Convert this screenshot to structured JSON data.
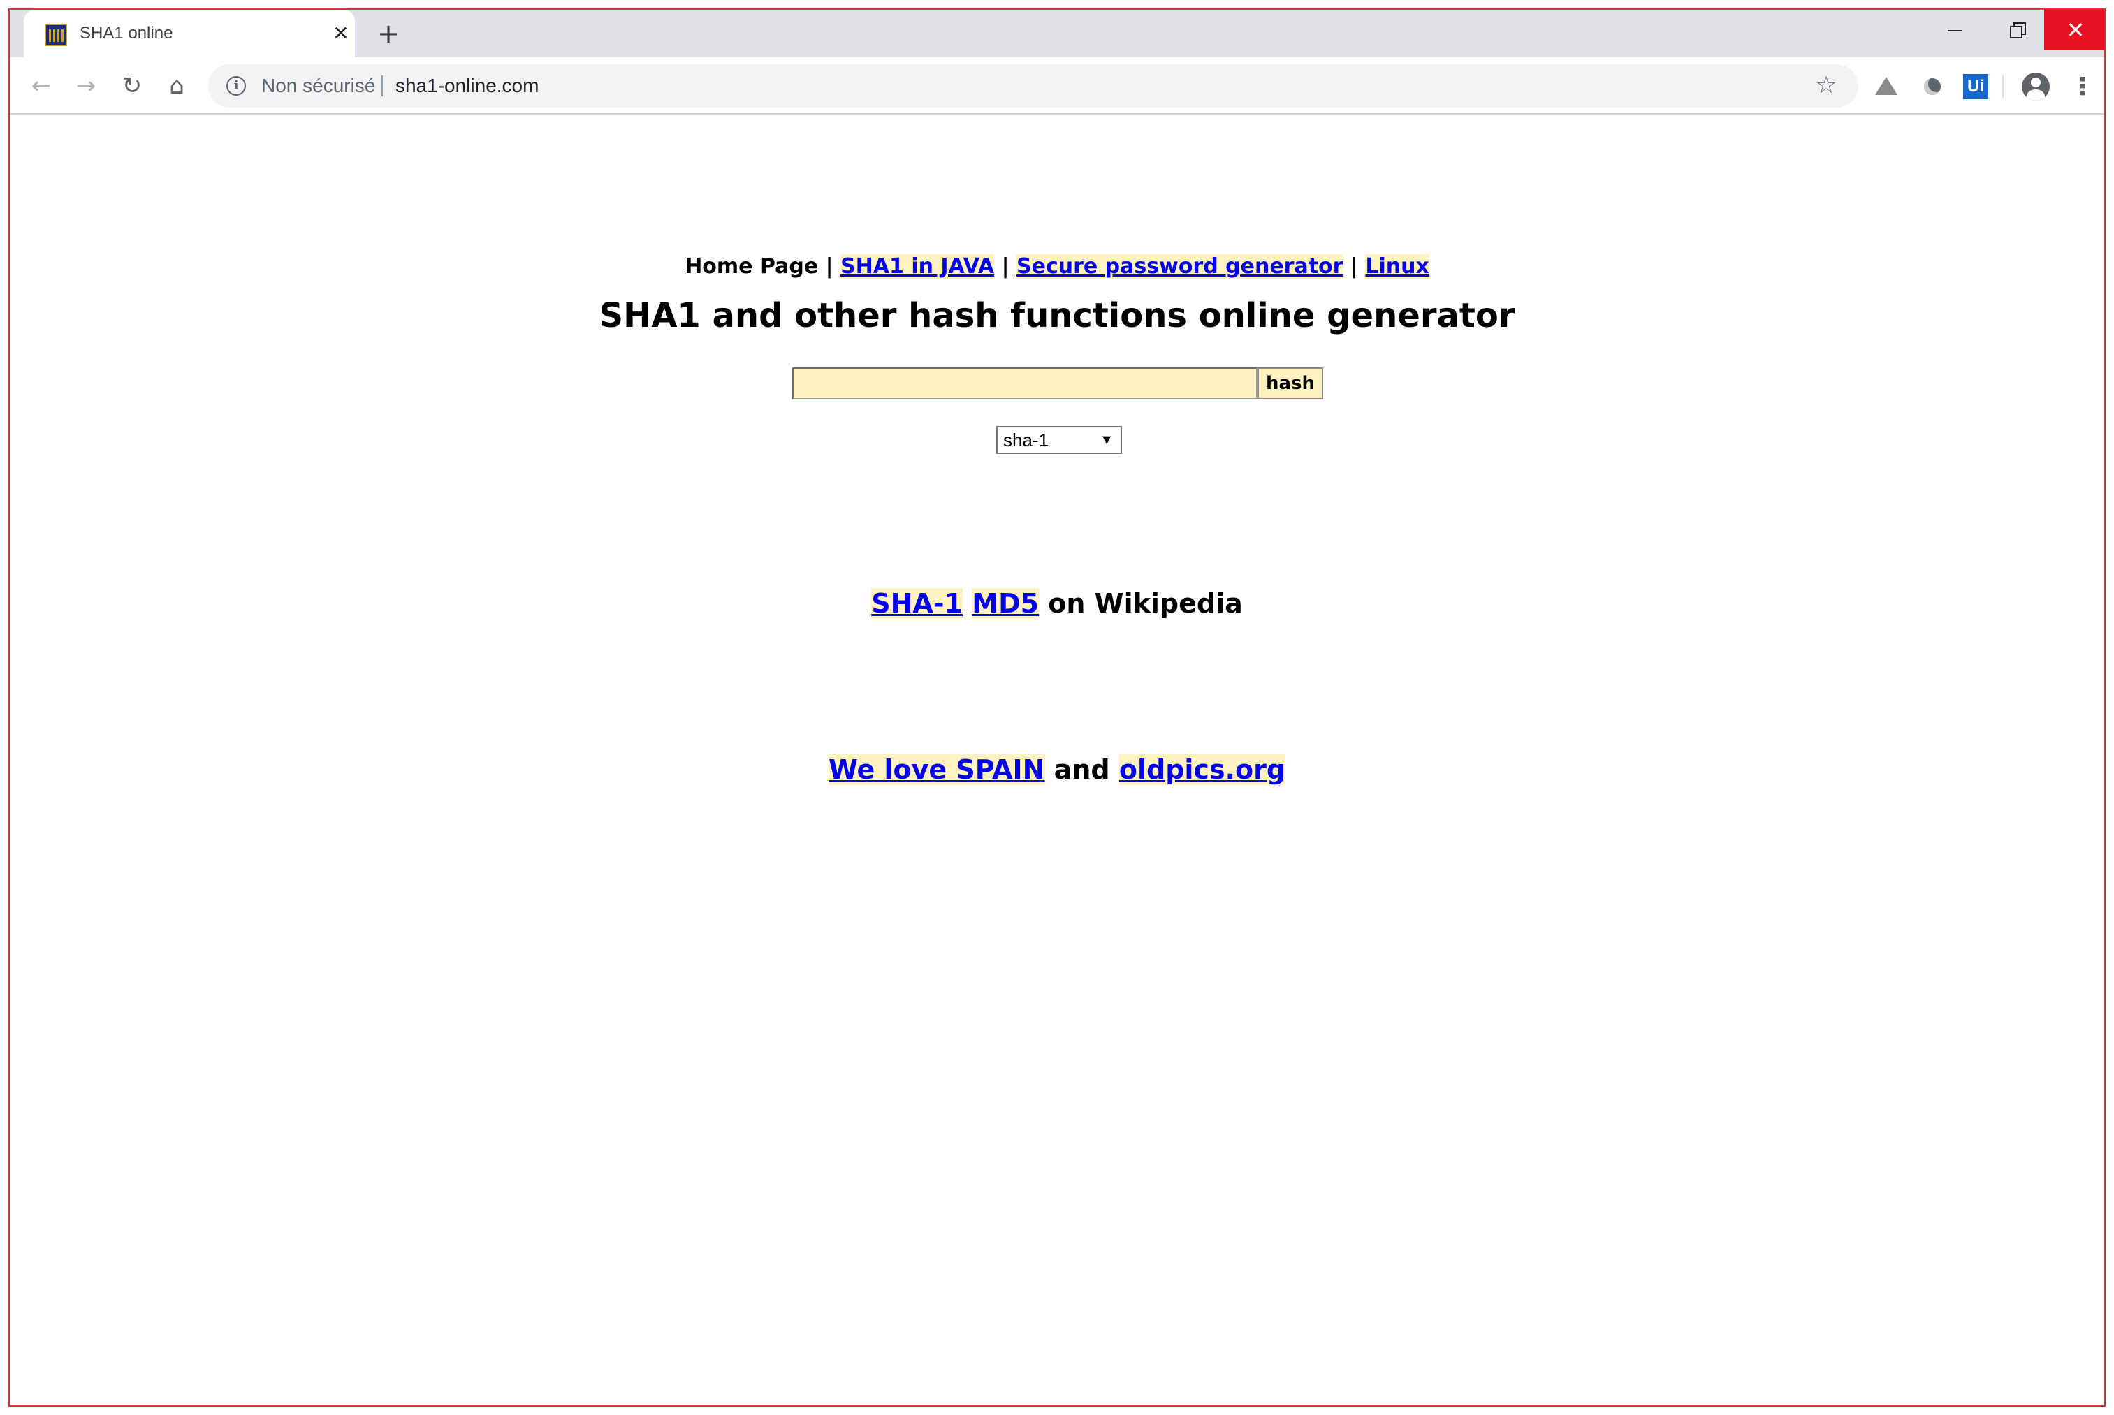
{
  "browser": {
    "tab": {
      "title": "SHA1 online",
      "close_glyph": "✕"
    },
    "new_tab_glyph": "+",
    "window_controls": {
      "close_glyph": "✕"
    },
    "nav": {
      "back_glyph": "←",
      "forward_glyph": "→",
      "reload_glyph": "↻",
      "home_glyph": "⌂"
    },
    "address_bar": {
      "security_label": "Non sécurisé",
      "url": "sha1-online.com",
      "info_glyph": "i",
      "star_glyph": "☆"
    },
    "extensions": {
      "ui_label": "Ui"
    },
    "menu_glyph": "⋮"
  },
  "page": {
    "topnav": {
      "home": "Home Page",
      "sep": " | ",
      "link_java": "SHA1 in JAVA",
      "link_password": "Secure password generator",
      "link_linux": "Linux"
    },
    "title": "SHA1 and other hash functions online generator",
    "form": {
      "input_value": "",
      "button_label": "hash",
      "algorithm_selected": "sha-1",
      "select_arrow": "▼"
    },
    "wiki": {
      "link_sha1": "SHA-1",
      "link_md5": "MD5",
      "suffix": "on Wikipedia"
    },
    "promo": {
      "link_spain": "We love SPAIN",
      "and": "and",
      "link_oldpics": "oldpics.org"
    }
  },
  "colors": {
    "link": "#0000ee",
    "link_highlight": "#fff2c0",
    "window_border": "#e0303a",
    "close_button": "#e81123"
  }
}
